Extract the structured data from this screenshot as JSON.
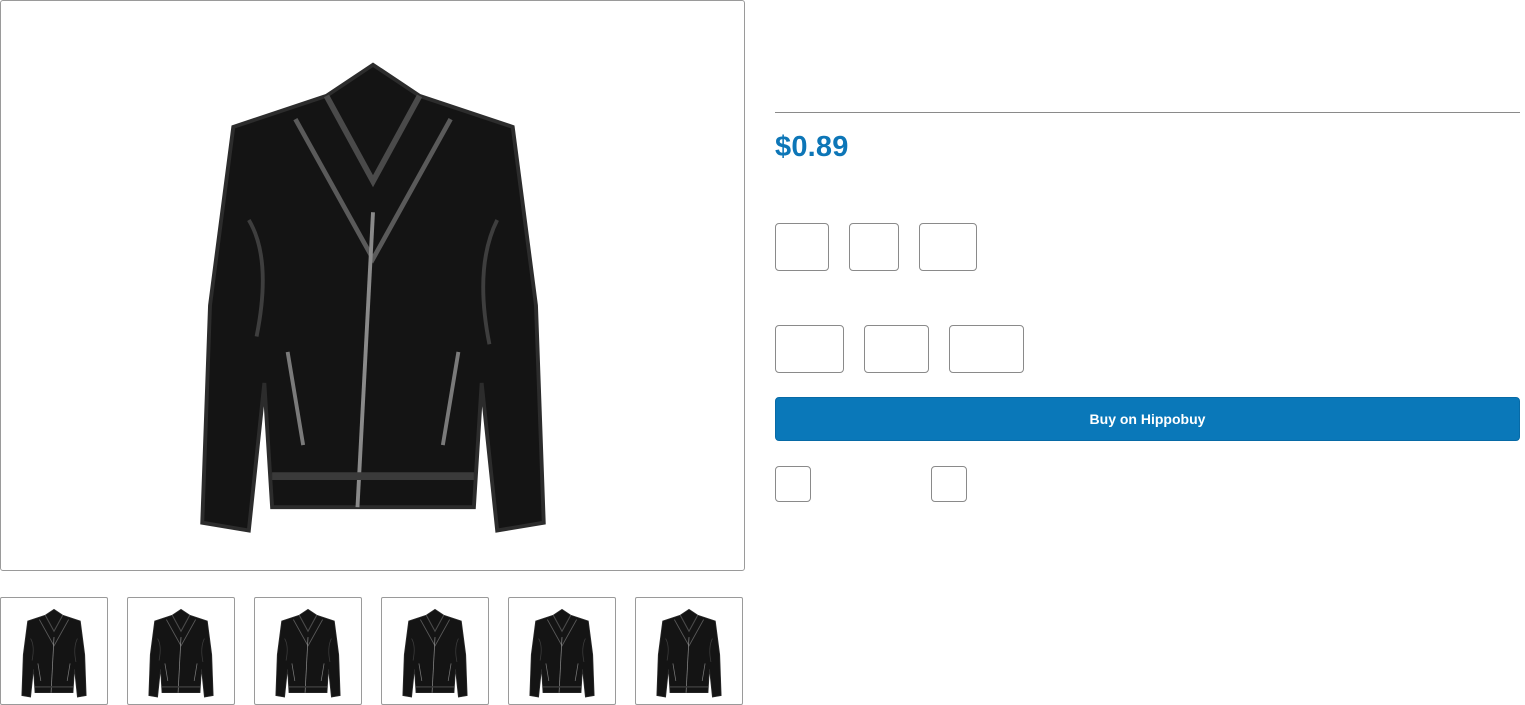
{
  "product": {
    "price": "$0.89",
    "buy_label": "Buy on Hippobuy",
    "image_subject": "black leather biker jacket"
  },
  "colors": {
    "accent": "#0a78b9",
    "price": "#0d76b7",
    "border": "#9a9a9a",
    "jacket": "#141414"
  },
  "icons": {
    "product": "jacket-icon"
  }
}
